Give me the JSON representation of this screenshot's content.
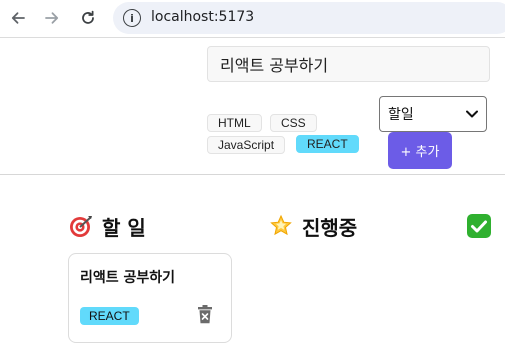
{
  "browser": {
    "url": "localhost:5173"
  },
  "form": {
    "title_value": "리액트 공부하기",
    "tags": [
      {
        "label": "HTML",
        "selected": false
      },
      {
        "label": "CSS",
        "selected": false
      },
      {
        "label": "JavaScript",
        "selected": false
      },
      {
        "label": "REACT",
        "selected": true
      }
    ],
    "status_select": {
      "selected": "할일"
    },
    "add_label": "+ 추가"
  },
  "columns": [
    {
      "title": "할 일",
      "icon": "target-icon"
    },
    {
      "title": "진행중",
      "icon": "glowing-star-icon"
    },
    {
      "title": "",
      "icon": "check-mark-button-icon"
    }
  ],
  "cards": [
    {
      "title": "리액트 공부하기",
      "tags": [
        "REACT"
      ],
      "delete_icon": "trash-icon"
    }
  ],
  "colors": {
    "accent": "#6c5ce7",
    "react_tag": "#61dafb"
  }
}
